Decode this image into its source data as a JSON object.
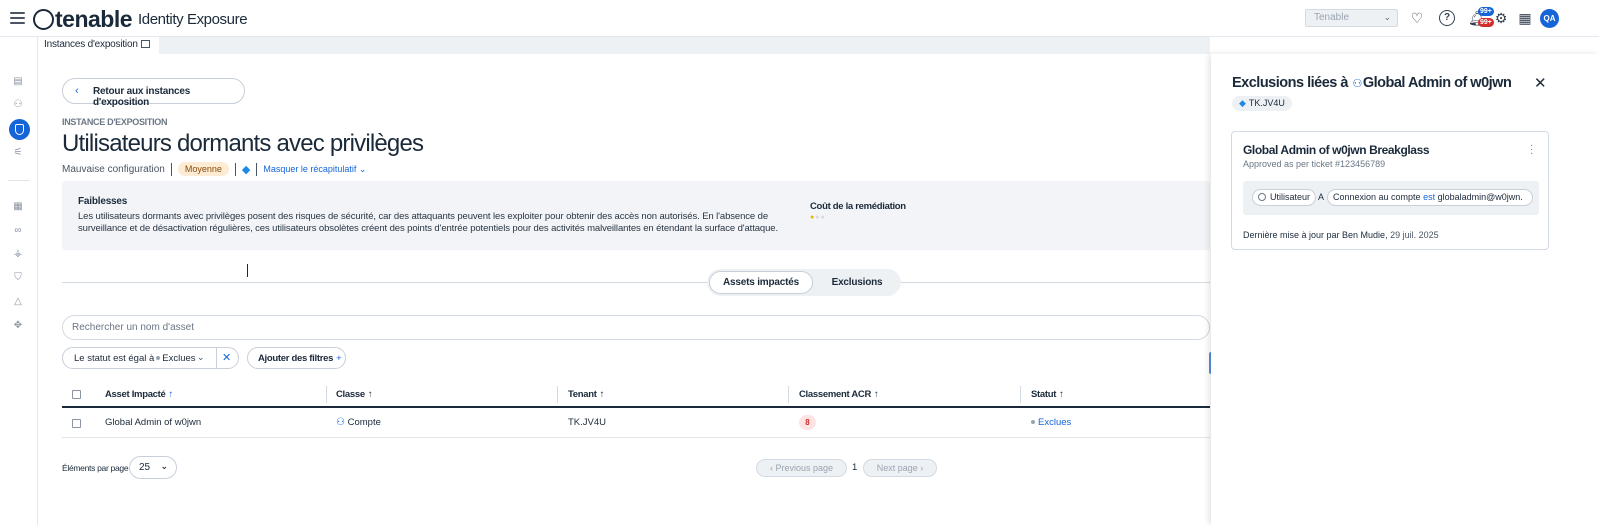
{
  "app": {
    "logo_word": "tenable",
    "logo_sub": "Identity Exposure",
    "tenant_select": "Tenable",
    "notif_badge_1": "99+",
    "notif_badge_2": "99+",
    "avatar": "QA",
    "accent": "#1565d8"
  },
  "tabs": [
    {
      "label": "Instances d'exposition"
    }
  ],
  "page": {
    "back_label": "Retour aux instances d'exposition",
    "eyebrow": "INSTANCE D'EXPOSITION",
    "title": "Utilisateurs dormants avec privilèges",
    "category": "Mauvaise configuration",
    "severity": "Moyenne",
    "toggle_summary": "Masquer le récapitulatif"
  },
  "summary": {
    "heading": "Faiblesses",
    "text": "Les utilisateurs dormants avec privilèges posent des risques de sécurité, car des attaquants peuvent les exploiter pour obtenir des accès non autorisés. En l'absence de surveillance et de désactivation régulières, ces utilisateurs obsolètes créent des points d'entrée potentiels pour des activités malveillantes en étendant la surface d'attaque.",
    "cost_heading": "Coût de la remédiation",
    "cost_level": 1,
    "cost_max": 3
  },
  "segments": {
    "active": "Assets impactés",
    "other": "Exclusions"
  },
  "search": {
    "placeholder": "Rechercher un nom d'asset"
  },
  "filters": {
    "active_prefix": "Le statut est égal à",
    "active_value": "Exclues",
    "add_label": "Ajouter des filtres"
  },
  "table": {
    "columns": [
      "Asset Impacté",
      "Classe",
      "Tenant",
      "Classement ACR",
      "Statut"
    ],
    "rows": [
      {
        "asset": "Global Admin of w0jwn",
        "class": "Compte",
        "tenant": "TK.JV4U",
        "acr": "8",
        "status": "Exclues"
      }
    ]
  },
  "pagination": {
    "per_page_label": "Éléments par page",
    "per_page": "25",
    "prev": "Previous page",
    "page": "1",
    "next": "Next page"
  },
  "panel": {
    "title_prefix": "Exclusions liées à",
    "title_account": "Global Admin of w0jwn",
    "tenant_tag": "TK.JV4U",
    "card": {
      "title": "Global Admin of w0jwn Breakglass",
      "subtitle": "Approved as per ticket #123456789",
      "cond_type": "Utilisateur",
      "cond_a": "A",
      "cond_field": "Connexion au compte",
      "cond_op": "est",
      "cond_value": "globaladmin@w0jwn.",
      "footer_prefix": "Dernière mise à jour par Ben Mudie,",
      "footer_date": "29 juil. 2025"
    }
  }
}
